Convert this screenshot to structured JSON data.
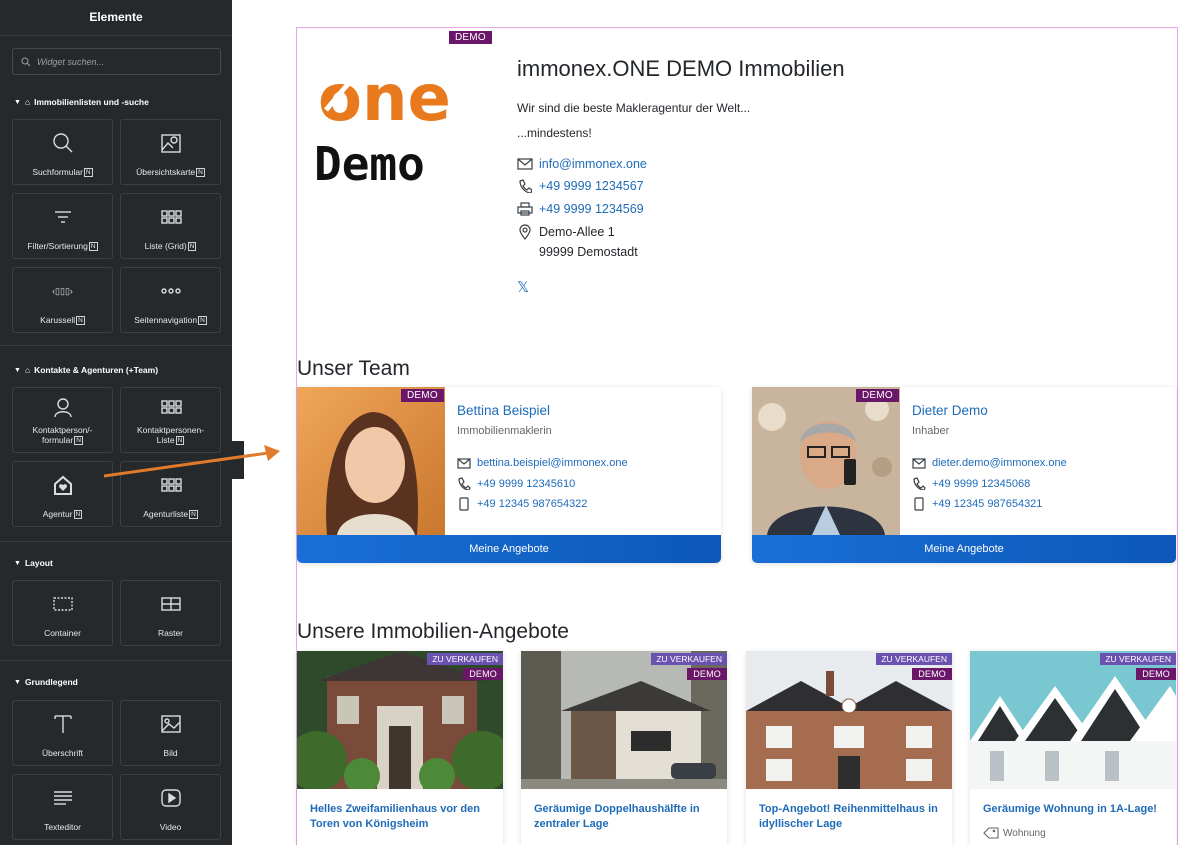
{
  "sidebar": {
    "title": "Elemente",
    "search_placeholder": "Widget suchen...",
    "categories": [
      {
        "label": "Immobilienlisten und -suche"
      },
      {
        "label": "Kontakte & Agenturen (+Team)"
      },
      {
        "label": "Layout"
      },
      {
        "label": "Grundlegend"
      }
    ],
    "widgets": {
      "suchformular": "Suchformular",
      "uebersichtskarte": "Übersichtskarte",
      "filter": "Filter/Sortierung",
      "liste_grid": "Liste (Grid)",
      "karussell": "Karussell",
      "seitennavigation": "Seitennavigation",
      "kontaktperson_l1": "Kontaktperson/-",
      "kontaktperson_l2": "formular",
      "kontaktliste_l1": "Kontaktpersonen-",
      "kontaktliste_l2": "Liste",
      "agentur": "Agentur",
      "agenturliste": "Agenturliste",
      "container": "Container",
      "raster": "Raster",
      "ueberschrift": "Überschrift",
      "bild": "Bild",
      "texteditor": "Texteditor",
      "video": "Video"
    },
    "badge": "N"
  },
  "agency": {
    "demo_badge": "DEMO",
    "logo_text_top": "one",
    "logo_text_bottom": "Demo",
    "name": "immonex.ONE DEMO Immobilien",
    "tagline": "Wir sind die beste Makleragentur der Welt...",
    "tagline2": "...mindestens!",
    "email": "info@immonex.one",
    "phone": "+49 9999 1234567",
    "fax": "+49 9999 1234569",
    "street": "Demo-Allee 1",
    "city": "99999 Demostadt",
    "social": "𝕏"
  },
  "team": {
    "heading": "Unser Team",
    "members": [
      {
        "name": "Bettina Beispiel",
        "role": "Immobilienmaklerin",
        "email": "bettina.beispiel@immonex.one",
        "phone": "+49 9999 12345610",
        "mobile": "+49 12345 987654322",
        "button": "Meine Angebote",
        "badge": "DEMO"
      },
      {
        "name": "Dieter Demo",
        "role": "Inhaber",
        "email": "dieter.demo@immonex.one",
        "phone": "+49 9999 12345068",
        "mobile": "+49 12345 987654321",
        "button": "Meine Angebote",
        "badge": "DEMO"
      }
    ]
  },
  "properties": {
    "heading": "Unsere Immobilien-Angebote",
    "sale_label": "ZU VERKAUFEN",
    "demo_label": "DEMO",
    "items": [
      {
        "title": "Helles Zweifamilienhaus vor den Toren von Königsheim"
      },
      {
        "title": "Geräumige Doppelhaushälfte in zentraler Lage"
      },
      {
        "title": "Top-Angebot! Reihenmittelhaus in idyllischer Lage"
      },
      {
        "title": "Geräumige Wohnung in 1A-Lage!",
        "type": "Wohnung"
      }
    ]
  },
  "colors": {
    "accent": "#1e6bb8",
    "demo": "#6b1769",
    "sale": "#6a52b0",
    "arrow": "#e07a2c"
  }
}
